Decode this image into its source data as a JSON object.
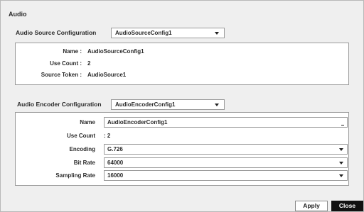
{
  "dialog": {
    "title": "Audio"
  },
  "source": {
    "label": "Audio Source Configuration",
    "selected": "AudioSourceConfig1",
    "name_label": "Name :",
    "name_value": "AudioSourceConfig1",
    "use_count_label": "Use Count :",
    "use_count_value": "2",
    "token_label": "Source Token :",
    "token_value": "AudioSource1"
  },
  "encoder": {
    "label": "Audio Encoder Configuration",
    "selected": "AudioEncoderConfig1",
    "name_label": "Name",
    "name_value": "AudioEncoderConfig1",
    "use_count_label": "Use Count",
    "use_count_value": ": 2",
    "encoding_label": "Encoding",
    "encoding_value": "G.726",
    "bitrate_label": "Bit Rate",
    "bitrate_value": "64000",
    "sampling_label": "Sampling Rate",
    "sampling_value": "16000"
  },
  "buttons": {
    "apply": "Apply",
    "close": "Close"
  }
}
